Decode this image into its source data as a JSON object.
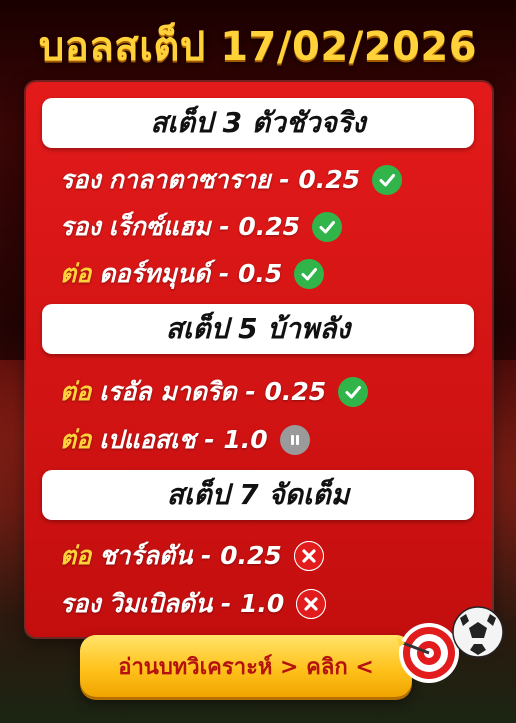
{
  "header": {
    "title": "บอลสเต็ป 17/02/2026"
  },
  "sections": [
    {
      "title": "สเต็ป 3 ตัวชัวจริง",
      "picks": [
        {
          "side": "รอง",
          "team": "กาลาตาซาราย - 0.25",
          "result": "win",
          "icon": "check-icon"
        },
        {
          "side": "รอง",
          "team": "เร็กซ์แฮม - 0.25",
          "result": "win",
          "icon": "check-icon"
        },
        {
          "side": "ต่อ",
          "team": "ดอร์ทมุนด์ - 0.5",
          "result": "win",
          "icon": "check-icon"
        }
      ]
    },
    {
      "title": "สเต็ป 5 บ้าพลัง",
      "picks": [
        {
          "side": "ต่อ",
          "team": "เรอัล มาดริด - 0.25",
          "result": "win",
          "icon": "check-icon"
        },
        {
          "side": "ต่อ",
          "team": "เปแอสเช - 1.0",
          "result": "pending",
          "icon": "pause-icon"
        }
      ]
    },
    {
      "title": "สเต็ป 7 จัดเต็ม",
      "picks": [
        {
          "side": "ต่อ",
          "team": "ชาร์ลตัน - 0.25",
          "result": "loss",
          "icon": "cross-icon"
        },
        {
          "side": "รอง",
          "team": "วิมเบิลดัน - 1.0",
          "result": "loss",
          "icon": "cross-icon"
        }
      ]
    }
  ],
  "cta": {
    "label": "อ่านบทวิเคราะห์ > คลิก <"
  },
  "colors": {
    "title": "#ffd23a",
    "panel": "#d81414",
    "tor": "#ffd23a",
    "roog": "#ffffff",
    "win": "#31b54a",
    "loss": "#e21c1c",
    "pending": "#9a9a9a",
    "cta": "#ffc21c"
  }
}
